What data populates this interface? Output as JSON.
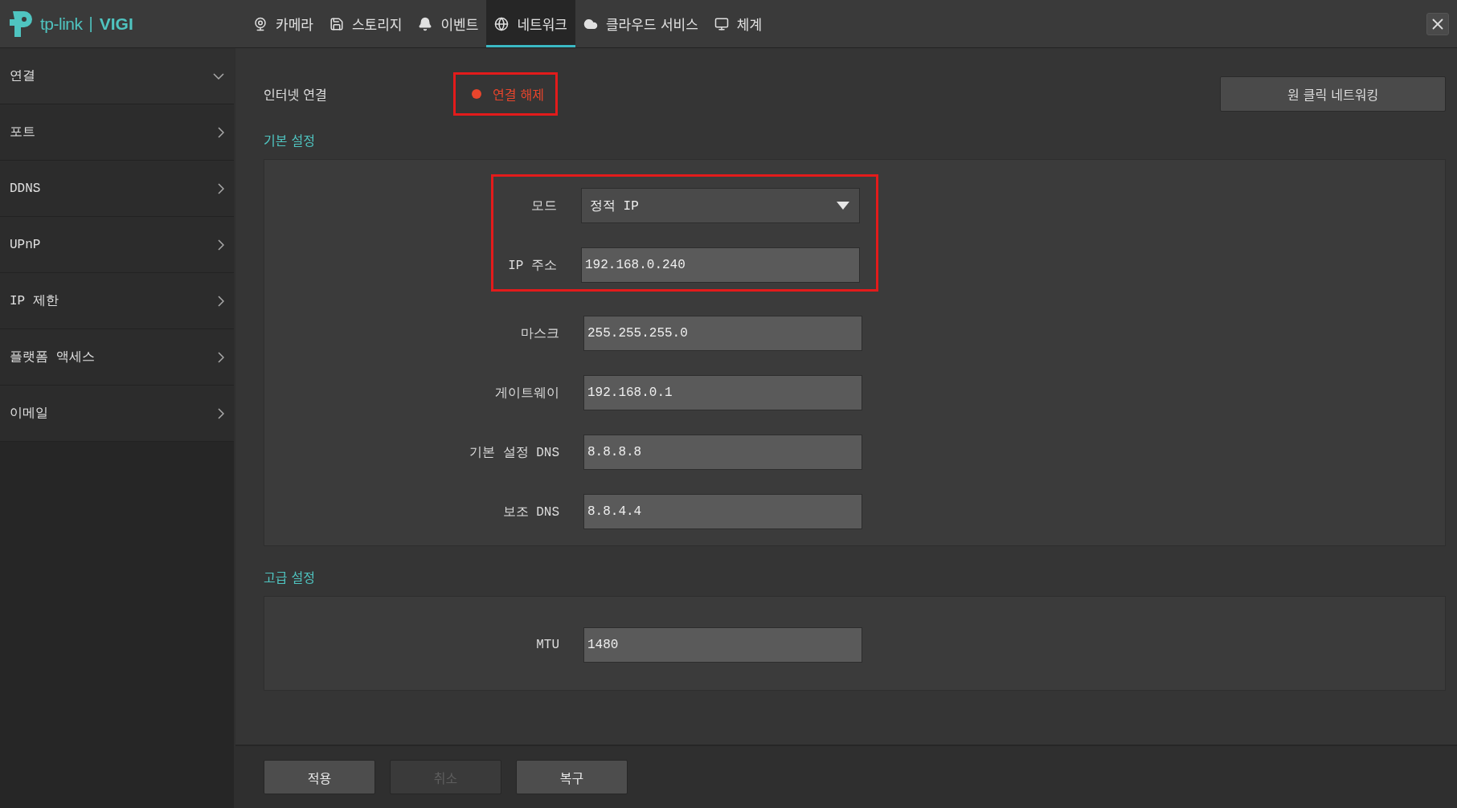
{
  "logo": {
    "brand": "tp-link",
    "divider": "|",
    "product": "VIGI"
  },
  "tabs": [
    {
      "label": "카메라",
      "kind": "camera",
      "selected": false
    },
    {
      "label": "스토리지",
      "kind": "storage",
      "selected": false
    },
    {
      "label": "이벤트",
      "kind": "bell",
      "selected": false
    },
    {
      "label": "네트워크",
      "kind": "globe",
      "selected": true
    },
    {
      "label": "클라우드 서비스",
      "kind": "cloud",
      "selected": false
    },
    {
      "label": "체계",
      "kind": "monitor",
      "selected": false
    }
  ],
  "sidebar": {
    "items": [
      {
        "label": "연결",
        "expanded": true
      },
      {
        "label": "포트",
        "expanded": false
      },
      {
        "label": "DDNS",
        "expanded": false
      },
      {
        "label": "UPnP",
        "expanded": false
      },
      {
        "label": "IP 제한",
        "expanded": false
      },
      {
        "label": "플랫폼 액세스",
        "expanded": false
      },
      {
        "label": "이메일",
        "expanded": false
      }
    ]
  },
  "internet": {
    "label": "인터넷 연결",
    "status": "연결 해제",
    "color": "#e8452c",
    "highlighted": true
  },
  "one_click_button": "원 클릭 네트워킹",
  "basic_settings": {
    "title": "기본 설정",
    "fields": [
      {
        "label": "모드",
        "kind": "select",
        "value": "정적 IP",
        "highlighted": true
      },
      {
        "label": "IP 주소",
        "kind": "input",
        "value": "192.168.0.240",
        "highlighted": true
      },
      {
        "label": "마스크",
        "kind": "input",
        "value": "255.255.255.0",
        "highlighted": false
      },
      {
        "label": "게이트웨이",
        "kind": "input",
        "value": "192.168.0.1",
        "highlighted": false
      },
      {
        "label": "기본 설정 DNS",
        "kind": "input",
        "value": "8.8.8.8",
        "highlighted": false
      },
      {
        "label": "보조 DNS",
        "kind": "input",
        "value": "8.8.4.4",
        "highlighted": false
      }
    ]
  },
  "advanced_settings": {
    "title": "고급 설정",
    "fields": [
      {
        "label": "MTU",
        "kind": "input",
        "value": "1480",
        "highlighted": false
      }
    ]
  },
  "footer_buttons": [
    {
      "label": "적용",
      "disabled": false
    },
    {
      "label": "취소",
      "disabled": true
    },
    {
      "label": "복구",
      "disabled": false
    }
  ]
}
